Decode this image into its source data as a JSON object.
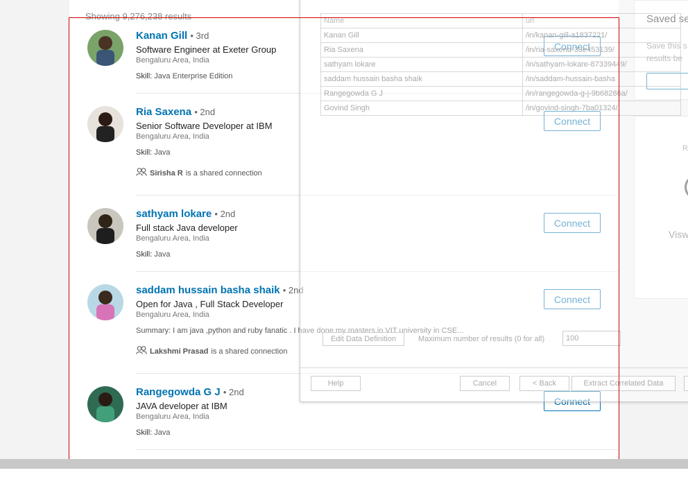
{
  "results": {
    "count_text": "Showing 9,276,238 results",
    "items": [
      {
        "name": "Kanan Gill",
        "degree": "• 3rd",
        "headline": "Software Engineer at Exeter Group",
        "location": "Bengaluru Area, India",
        "skill_label": "Skill:",
        "skill": "Java Enterprise Edition",
        "shared": null,
        "summary": null,
        "connect": "Connect"
      },
      {
        "name": "Ria Saxena",
        "degree": "• 2nd",
        "headline": "Senior Software Developer at IBM",
        "location": "Bengaluru Area, India",
        "skill_label": "Skill:",
        "skill": "Java",
        "shared": {
          "who": "Sirisha R",
          "text": "is a shared connection"
        },
        "summary": null,
        "connect": "Connect"
      },
      {
        "name": "sathyam lokare",
        "degree": "• 2nd",
        "headline": "Full stack Java developer",
        "location": "Bengaluru Area, India",
        "skill_label": "Skill:",
        "skill": "Java",
        "shared": null,
        "summary": null,
        "connect": "Connect"
      },
      {
        "name": "saddam hussain basha shaik",
        "degree": "• 2nd",
        "headline": "Open for Java , Full Stack Developer",
        "location": "Bengaluru Area, India",
        "skill_label": null,
        "skill": null,
        "shared": {
          "who": "Lakshmi Prasad",
          "text": "is a shared connection"
        },
        "summary": "Summary: I am java ,python and ruby fanatic . I have done my masters in VIT university in CSE...",
        "connect": "Connect"
      },
      {
        "name": "Rangegowda G J",
        "degree": "• 2nd",
        "headline": "JAVA developer at IBM",
        "location": "Bengaluru Area, India",
        "skill_label": "Skill:",
        "skill": "Java",
        "shared": null,
        "summary": null,
        "connect": "Connect"
      }
    ]
  },
  "sidebar": {
    "saved_title": "Saved se",
    "saved_text_1": "Save this s",
    "saved_text_2": "results be",
    "card2_r": "R",
    "card2_view": "Visw"
  },
  "dialog": {
    "columns": [
      "Name",
      "url"
    ],
    "rows": [
      [
        "Kanan Gill",
        "/in/kanan-gill-a1837221/"
      ],
      [
        "Ria Saxena",
        "/in/ria-saxena-33e453139/"
      ],
      [
        "sathyam lokare",
        "/in/sathyam-lokare-87339449/"
      ],
      [
        "saddam hussain basha shaik",
        "/in/saddam-hussain-basha"
      ],
      [
        "Rangegowda G J",
        "/in/rangegowda-g-j-9b68286a/"
      ],
      [
        "Govind Singh",
        "/in/govind-singh-7ba01324/"
      ]
    ],
    "edit_button": "Edit Data Definition",
    "max_label": "Maximum number of results (0 for all)",
    "max_value": "100",
    "footer": {
      "help": "Help",
      "cancel": "Cancel",
      "back": "< Back",
      "extract": "Extract Correlated Data"
    }
  },
  "colors": {
    "accent": "#0073b1",
    "highlight": "#d00000"
  }
}
